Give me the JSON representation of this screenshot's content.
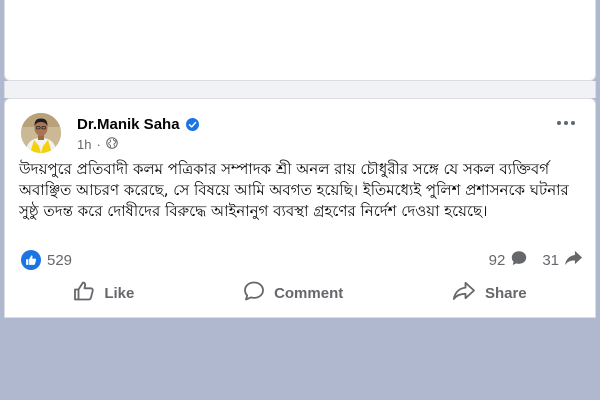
{
  "colors": {
    "backdrop": "#b0b8d0",
    "card": "#ffffff",
    "text_primary": "#050505",
    "text_secondary": "#65676b",
    "brand_blue": "#1b74e4"
  },
  "post": {
    "author": "Dr.Manik Saha",
    "verified_icon": "verified-badge-icon",
    "time": "1h",
    "audience_icon": "globe-icon",
    "more_icon": "more-options-icon",
    "text": "উদয়পুরে প্রতিবাদী কলম পত্রিকার সম্পাদক শ্রী অনল রায় চৌধুরীর সঙ্গে যে সকল ব্যক্তিবর্গ অবাঞ্ছিত আচরণ করেছে, সে বিষয়ে আমি অবগত হয়েছি। ইতিমধ্যেই পুলিশ প্রশাসনকে ঘটনার সুষ্ঠু তদন্ত করে দোষীদের বিরুদ্ধে আইনানুগ ব্যবস্থা গ্রহণের নির্দেশ দেওয়া হয়েছে।"
  },
  "stats": {
    "reactions": "529",
    "comments": "92",
    "shares": "31"
  },
  "actions": {
    "like": "Like",
    "comment": "Comment",
    "share": "Share"
  }
}
